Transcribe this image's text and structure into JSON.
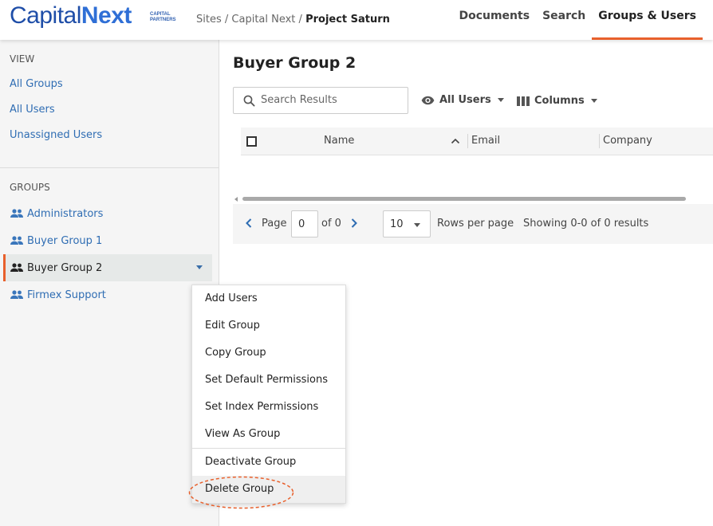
{
  "header": {
    "logo_a": "Capital",
    "logo_b": "Next",
    "logo_sub1": "CAPITAL",
    "logo_sub2": "PARTNERS",
    "breadcrumb": {
      "sites": "Sites",
      "sep1": "/",
      "project": "Capital Next",
      "sep2": "/",
      "current": "Project Saturn"
    },
    "nav": [
      "Documents",
      "Search",
      "Groups & Users"
    ],
    "active_nav": "Groups & Users"
  },
  "sidebar": {
    "view_title": "VIEW",
    "view_links": [
      "All Groups",
      "All Users",
      "Unassigned Users"
    ],
    "groups_title": "GROUPS",
    "groups": [
      "Administrators",
      "Buyer Group 1",
      "Buyer Group 2",
      "Firmex Support"
    ],
    "active_group": "Buyer Group 2"
  },
  "main": {
    "title": "Buyer Group 2",
    "search_placeholder": "Search Results",
    "filter_label": "All Users",
    "columns_label": "Columns",
    "table_headers": [
      "Name",
      "Email",
      "Company"
    ],
    "pager": {
      "page_label": "Page",
      "page_value": "0",
      "of_label": "of 0",
      "rows_value": "10",
      "rows_label": "Rows per page",
      "showing": "Showing 0-0 of 0 results"
    }
  },
  "context_menu": {
    "items": [
      "Add Users",
      "Edit Group",
      "Copy Group",
      "Set Default Permissions",
      "Set Index Permissions",
      "View As Group",
      "Deactivate Group",
      "Delete Group"
    ],
    "highlighted": "Delete Group"
  },
  "colors": {
    "accent": "#e8602c",
    "link": "#2f6db3",
    "brand": "#1f4ea8"
  }
}
